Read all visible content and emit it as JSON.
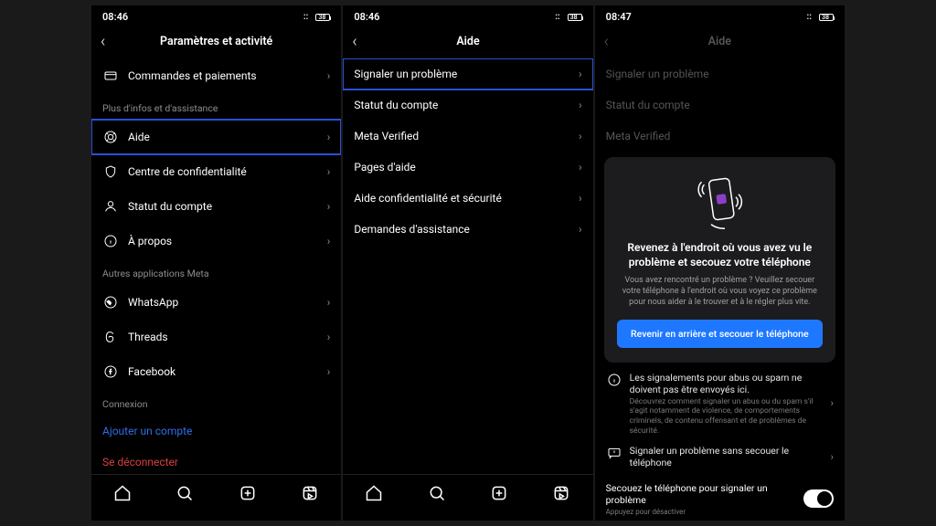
{
  "screen1": {
    "time": "08:46",
    "battery": "38",
    "title": "Paramètres et activité",
    "row_commands": "Commandes et paiements",
    "section_more": "Plus d'infos et d'assistance",
    "row_help": "Aide",
    "row_privacy": "Centre de confidentialité",
    "row_status": "Statut du compte",
    "row_about": "À propos",
    "section_meta": "Autres applications Meta",
    "row_whatsapp": "WhatsApp",
    "row_threads": "Threads",
    "row_facebook": "Facebook",
    "section_conn": "Connexion",
    "row_add": "Ajouter un compte",
    "row_logout": "Se déconnecter"
  },
  "screen2": {
    "time": "08:46",
    "battery": "38",
    "title": "Aide",
    "row_report": "Signaler un problème",
    "row_status": "Statut du compte",
    "row_verified": "Meta Verified",
    "row_helppages": "Pages d'aide",
    "row_privsec": "Aide confidentialité et sécurité",
    "row_support": "Demandes d'assistance"
  },
  "screen3": {
    "time": "08:47",
    "battery": "38",
    "title": "Aide",
    "row_report": "Signaler un problème",
    "row_status": "Statut du compte",
    "row_verified": "Meta Verified",
    "card_title": "Revenez à l'endroit où vous avez vu le problème et secouez votre téléphone",
    "card_sub": "Vous avez rencontré un problème ? Veuillez secouer votre téléphone à l'endroit où vous voyez ce problème pour nous aider à le trouver et à le régler plus vite.",
    "cta": "Revenir en arrière et secouer le téléphone",
    "info1_t": "Les signalements pour abus ou spam ne doivent pas être envoyés ici.",
    "info1_s": "Découvrez comment signaler un abus ou du spam s'il s'agit notamment de violence, de comportements criminels, de contenu offensant et de problèmes de sécurité.",
    "info2": "Signaler un problème sans secouer le téléphone",
    "toggle_t": "Secouez le téléphone pour signaler un problème",
    "toggle_s": "Appuyez pour désactiver"
  }
}
